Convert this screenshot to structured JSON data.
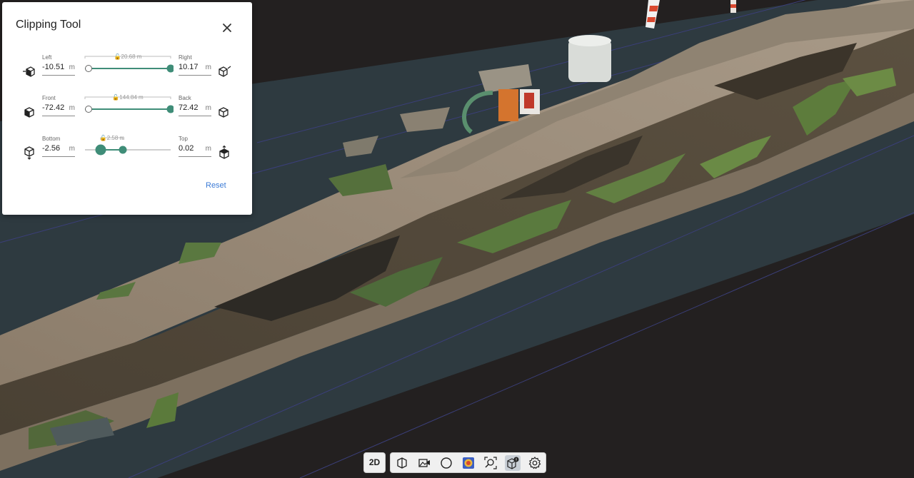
{
  "panel": {
    "title": "Clipping Tool",
    "reset_label": "Reset",
    "rows": [
      {
        "label_a": "Left",
        "value_a": "-10.51",
        "label_b": "Right",
        "value_b": "10.17",
        "unit": "m",
        "span": "20.68 m",
        "handle_a": 0.0,
        "handle_b": 1.0
      },
      {
        "label_a": "Front",
        "value_a": "-72.42",
        "label_b": "Back",
        "value_b": "72.42",
        "unit": "m",
        "span": "144.84 m",
        "handle_a": 0.0,
        "handle_b": 1.0
      },
      {
        "label_a": "Bottom",
        "value_a": "-2.56",
        "label_b": "Top",
        "value_b": "0.02",
        "unit": "m",
        "span": "2.58 m",
        "handle_a": 0.16,
        "handle_b": 0.41
      }
    ]
  },
  "toolbar": {
    "mode_label": "2D",
    "tools": [
      {
        "name": "cube-view-icon",
        "active": false
      },
      {
        "name": "image-camera-icon",
        "active": false
      },
      {
        "name": "circle-icon",
        "active": false
      },
      {
        "name": "color-mode-icon",
        "active": false
      },
      {
        "name": "zoom-extent-icon",
        "active": false
      },
      {
        "name": "clipping-box-icon",
        "active": true
      },
      {
        "name": "settings-gear-icon",
        "active": false
      }
    ]
  },
  "colors": {
    "accent": "#3f8d78",
    "link": "#3c7bd6",
    "background": "#232020",
    "ground_plane": "#2e3a40"
  }
}
